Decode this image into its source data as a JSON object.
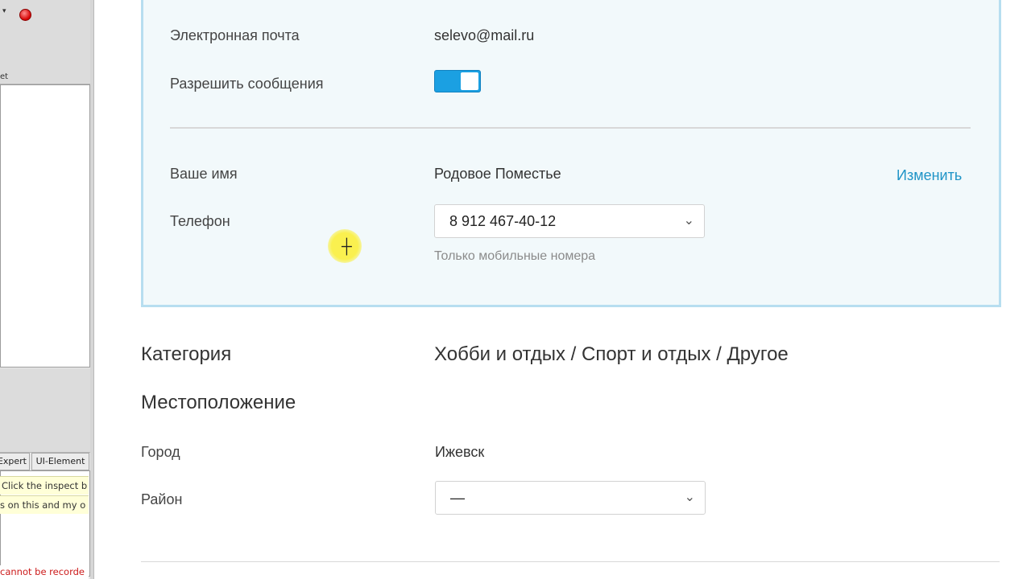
{
  "tool_panel": {
    "small_arrow": "▾",
    "column_header": "et",
    "tabs": [
      "Expert",
      "UI-Element"
    ],
    "hint_lines": [
      "Click the inspect b",
      "s on this and my o"
    ],
    "error_text": "cannot be recorde",
    "close_color": "#d40000"
  },
  "contact": {
    "email_label": "Электронная почта",
    "email_value": "selevo@mail.ru",
    "allow_messages_label": "Разрешить сообщения",
    "allow_messages_on": true,
    "name_label": "Ваше имя",
    "name_value": "Родовое Поместье",
    "change_link": "Изменить",
    "phone_label": "Телефон",
    "phone_value": "8 912 467-40-12",
    "phone_hint": "Только мобильные номера"
  },
  "category": {
    "label": "Категория",
    "value": "Хобби и отдых / Спорт и отдых / Другое"
  },
  "location": {
    "heading": "Местоположение",
    "city_label": "Город",
    "city_value": "Ижевск",
    "district_label": "Район",
    "district_value": "—"
  },
  "icons": {
    "dropdown": "chevron-down-icon",
    "close": "close-circle-icon"
  },
  "colors": {
    "accent": "#1ba0e2",
    "link": "#1f94c7",
    "box_border": "#b7def0",
    "cursor_highlight": "#faf046"
  }
}
